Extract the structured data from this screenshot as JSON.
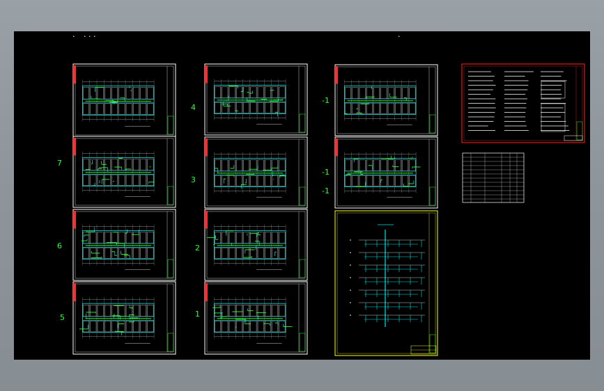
{
  "app": {
    "background_color": "#8e959b",
    "canvas_color": "#000000"
  },
  "colors": {
    "sheet_border": "#ffffff",
    "title_tab": "#ff2a2a",
    "level_label": "#33ff33",
    "wall": "#00e5e5",
    "pipe": "#33ff33",
    "riser_sheet_border": "#ffff33",
    "legend_sheet_border": "#ff2222"
  },
  "labels": {
    "left_column": [
      "7",
      "6",
      "5"
    ],
    "middle_column": [
      "4",
      "3",
      "2",
      "1"
    ],
    "right_column": [
      "-1",
      "-1",
      "-1"
    ]
  },
  "header": {
    "marks": [
      ".",
      ". . .",
      "."
    ]
  }
}
